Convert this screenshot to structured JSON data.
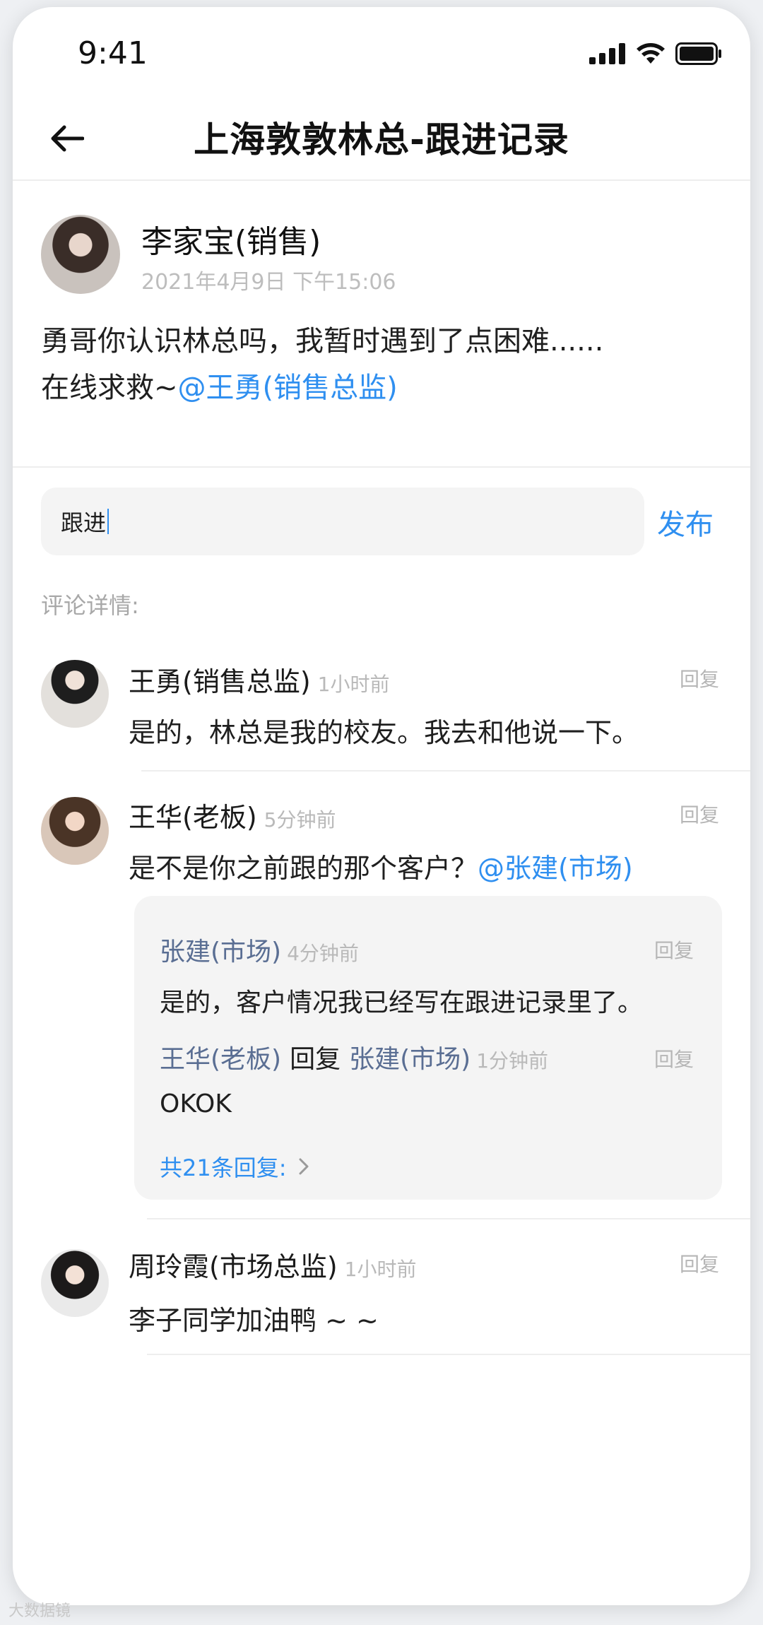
{
  "status_bar": {
    "time": "9:41"
  },
  "nav": {
    "title": "上海敦敦林总-跟进记录"
  },
  "post": {
    "author": "李家宝(销售)",
    "time": "2021年4月9日 下午15:06",
    "content_line1": "勇哥你认识林总吗，我暂时遇到了点困难......",
    "content_line2_prefix": "在线求救~",
    "content_mention": "@王勇(销售总监)"
  },
  "input": {
    "value": "跟进",
    "publish_label": "发布"
  },
  "comments_label": "评论详情:",
  "comments": [
    {
      "author": "王勇(销售总监)",
      "time": "1小时前",
      "reply_label": "回复",
      "content": "是的，林总是我的校友。我去和他说一下。"
    },
    {
      "author": "王华(老板)",
      "time": "5分钟前",
      "reply_label": "回复",
      "content": "是不是你之前跟的那个客户？",
      "mention": "@张建(市场)",
      "replies": [
        {
          "author": "张建(市场)",
          "time": "4分钟前",
          "reply_label": "回复",
          "content": "是的，客户情况我已经写在跟进记录里了。"
        },
        {
          "author": "王华(老板)",
          "action": "回复",
          "target": "张建(市场)",
          "time": "1分钟前",
          "reply_label": "回复",
          "content": "OKOK"
        }
      ],
      "total_replies": "共21条回复:"
    },
    {
      "author": "周玲霞(市场总监)",
      "time": "1小时前",
      "reply_label": "回复",
      "content": "李子同学加油鸭 ~ ~"
    }
  ],
  "watermark": "大数据镜",
  "icons": [
    "signal-icon",
    "wifi-icon",
    "battery-icon",
    "back-arrow-icon",
    "chevron-right-icon"
  ],
  "colors": {
    "accent": "#2f8ff0",
    "name_link": "#5a6e93",
    "muted": "#b9b9b9",
    "bg_card": "#f4f4f4"
  }
}
